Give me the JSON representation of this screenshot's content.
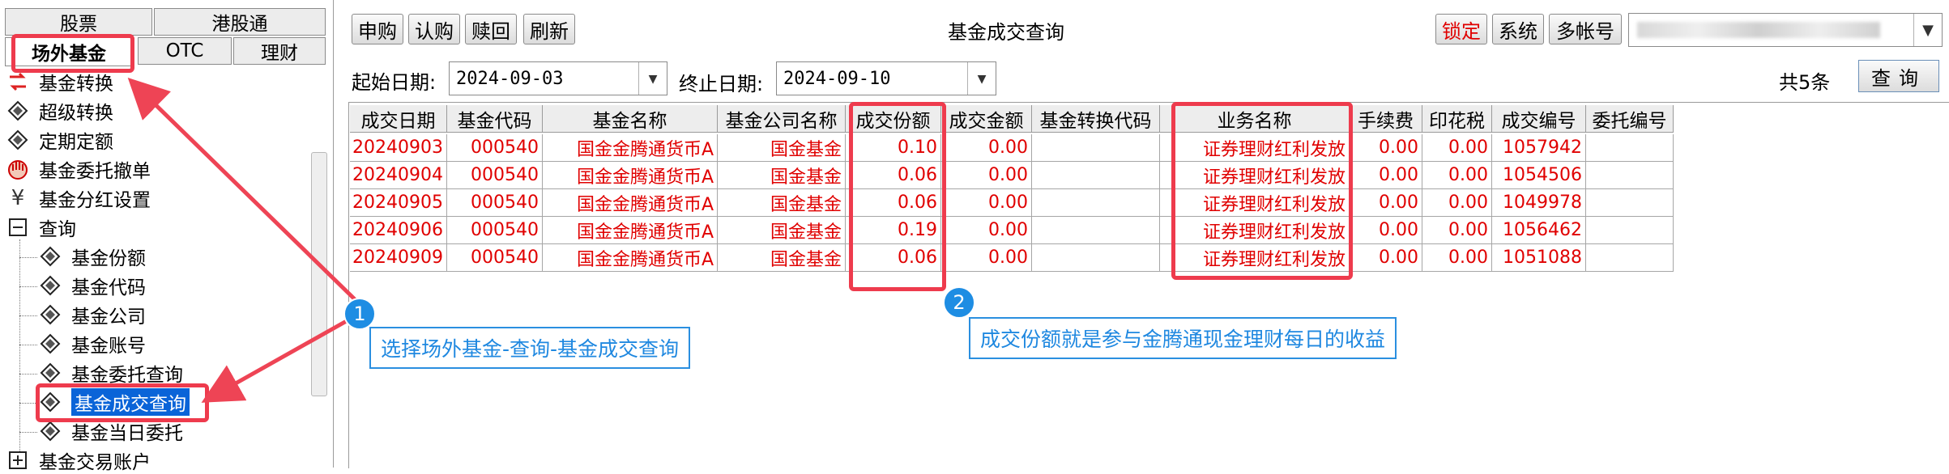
{
  "left_tabs": {
    "stocks": "股票",
    "hk_connect": "港股通",
    "otc_fund": "场外基金",
    "otc": "OTC",
    "wealth": "理财"
  },
  "tree": {
    "items": [
      {
        "label": "基金转换",
        "icon": "fund-transfer-icon"
      },
      {
        "label": "超级转换",
        "icon": "fund-icon"
      },
      {
        "label": "定期定额",
        "icon": "fund-icon"
      },
      {
        "label": "基金委托撤单",
        "icon": "cancel-hand-icon"
      },
      {
        "label": "基金分红设置",
        "icon": "yuan-icon"
      },
      {
        "label": "查询",
        "icon": "collapse-minus-icon"
      },
      {
        "label": "基金份额",
        "icon": "fund-icon"
      },
      {
        "label": "基金代码",
        "icon": "fund-icon"
      },
      {
        "label": "基金公司",
        "icon": "fund-icon"
      },
      {
        "label": "基金账号",
        "icon": "fund-icon"
      },
      {
        "label": "基金委托查询",
        "icon": "fund-icon"
      },
      {
        "label": "基金成交查询",
        "icon": "fund-icon",
        "selected": true
      },
      {
        "label": "基金当日委托",
        "icon": "fund-icon"
      },
      {
        "label": "基金交易账户",
        "icon": "expand-plus-icon"
      }
    ]
  },
  "toolbar": {
    "subscribe": "申购",
    "subscribe_ipo": "认购",
    "redeem": "赎回",
    "refresh": "刷新",
    "title": "基金成交查询",
    "lock": "锁定",
    "system": "系统",
    "multi_account": "多帐号"
  },
  "filter": {
    "start_label": "起始日期:",
    "start_value": "2024-09-03",
    "end_label": "终止日期:",
    "end_value": "2024-09-10",
    "count": "共5条",
    "query": "查询"
  },
  "table": {
    "headers": [
      "成交日期",
      "基金代码",
      "基金名称",
      "基金公司名称",
      "成交份额",
      "成交金额",
      "基金转换代码",
      "业务名称",
      "手续费",
      "印花税",
      "成交编号",
      "委托编号"
    ],
    "rows": [
      [
        "20240903",
        "000540",
        "国金金腾通货币A",
        "国金基金",
        "0.10",
        "0.00",
        "",
        "证券理财红利发放",
        "0.00",
        "0.00",
        "1057942",
        ""
      ],
      [
        "20240904",
        "000540",
        "国金金腾通货币A",
        "国金基金",
        "0.06",
        "0.00",
        "",
        "证券理财红利发放",
        "0.00",
        "0.00",
        "1054506",
        ""
      ],
      [
        "20240905",
        "000540",
        "国金金腾通货币A",
        "国金基金",
        "0.06",
        "0.00",
        "",
        "证券理财红利发放",
        "0.00",
        "0.00",
        "1049978",
        ""
      ],
      [
        "20240906",
        "000540",
        "国金金腾通货币A",
        "国金基金",
        "0.19",
        "0.00",
        "",
        "证券理财红利发放",
        "0.00",
        "0.00",
        "1056462",
        ""
      ],
      [
        "20240909",
        "000540",
        "国金金腾通货币A",
        "国金基金",
        "0.06",
        "0.00",
        "",
        "证券理财红利发放",
        "0.00",
        "0.00",
        "1051088",
        ""
      ]
    ]
  },
  "annotations": {
    "badge1": "1",
    "note1": "选择场外基金-查询-基金成交查询",
    "badge2": "2",
    "note2": "成交份额就是参与金腾通现金理财每日的收益"
  },
  "colors": {
    "accent_red": "#ee3b4d",
    "data_red": "#e00000",
    "selection_blue": "#0a64d8",
    "annotation_blue": "#1e8de3"
  }
}
